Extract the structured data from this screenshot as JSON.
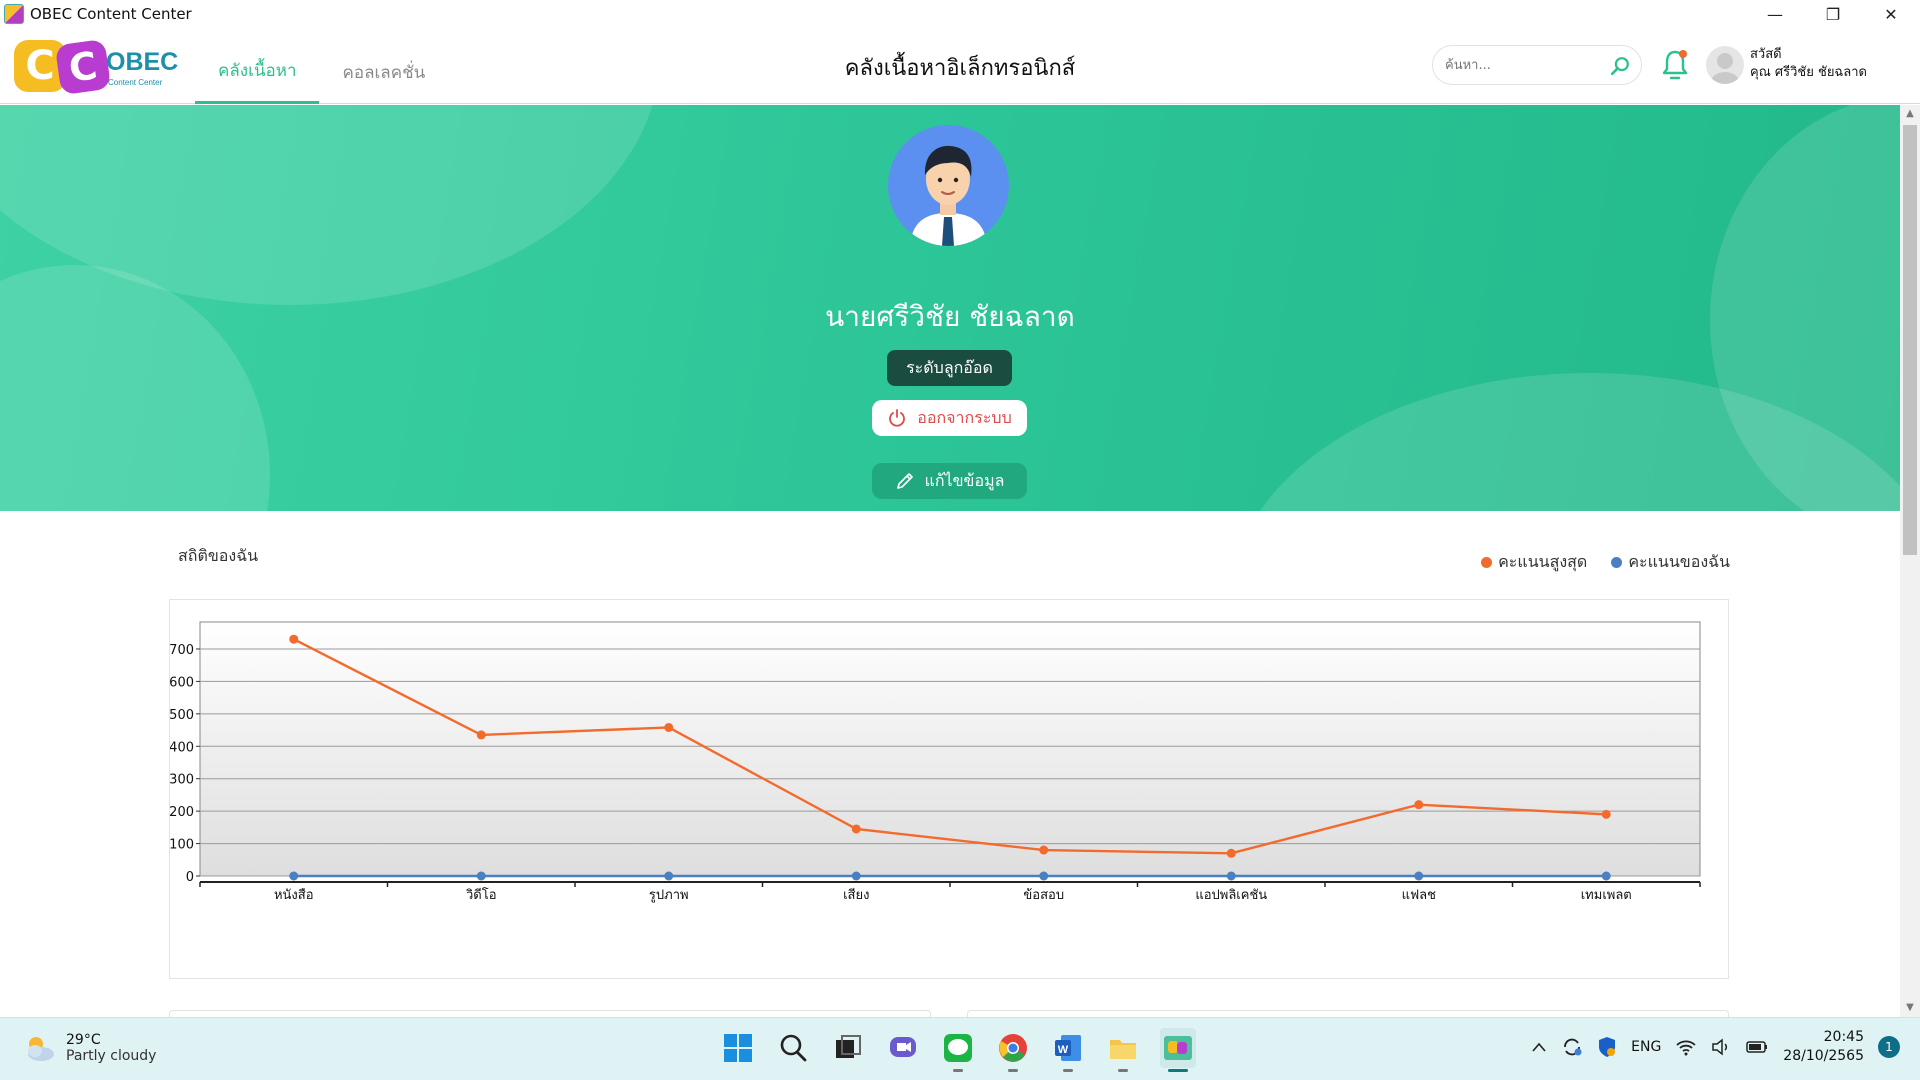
{
  "window": {
    "title": "OBEC Content Center",
    "min": "—",
    "restore": "❐",
    "close": "✕"
  },
  "header": {
    "logo_text": "OBEC",
    "logo_sub": "Content Center",
    "logo_letters": [
      "C",
      "C"
    ],
    "tabs": [
      {
        "label": "คลังเนื้อหา",
        "active": true
      },
      {
        "label": "คอลเลคชั่น",
        "active": false
      }
    ],
    "page_title": "คลังเนื้อหาอิเล็กทรอนิกส์",
    "search_placeholder": "ค้นหา...",
    "greeting": "สวัสดี",
    "user_short": "คุณ ศรีวิชัย ชัยฉลาด"
  },
  "profile": {
    "name": "นายศรีวิชัย ชัยฉลาด",
    "level": "ระดับลูกอ๊อด",
    "logout": "ออกจากระบบ",
    "edit": "แก้ไขข้อมูล"
  },
  "stats": {
    "title": "สถิติของฉัน"
  },
  "colors": {
    "accent": "#2ebf8e",
    "max_series": "#f26b2d",
    "my_series": "#4a7fc1",
    "banner": "#2cc597"
  },
  "chart_data": {
    "type": "line",
    "categories": [
      "หนังสือ",
      "วิดีโอ",
      "รูปภาพ",
      "เสียง",
      "ข้อสอบ",
      "แอปพลิเคชัน",
      "แฟลช",
      "เทมเพลต"
    ],
    "series": [
      {
        "name": "คะแนนสูงสุด",
        "color": "#f26b2d",
        "values": [
          730,
          435,
          458,
          145,
          80,
          70,
          220,
          190
        ]
      },
      {
        "name": "คะแนนของฉัน",
        "color": "#4a7fc1",
        "values": [
          0,
          0,
          0,
          0,
          0,
          0,
          0,
          0
        ]
      }
    ],
    "yticks": [
      0,
      100,
      200,
      300,
      400,
      500,
      600,
      700
    ],
    "ylim": [
      0,
      740
    ],
    "grid": true,
    "legend_position": "top-right"
  },
  "taskbar": {
    "temperature": "29°C",
    "condition": "Partly cloudy",
    "language": "ENG",
    "time": "20:45",
    "date": "28/10/2565",
    "notifications": "1"
  }
}
